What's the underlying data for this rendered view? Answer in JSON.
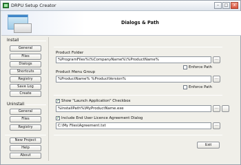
{
  "window": {
    "title": "DRPU Setup Creator",
    "controls": {
      "minimize": "–",
      "maximize": "□",
      "close": "x"
    }
  },
  "header": {
    "title": "Dialogs & Path"
  },
  "sidebar": {
    "install_label": "Install",
    "install_items": [
      "General",
      "Files",
      "Dialogs",
      "Shortcuts",
      "Registry",
      "Save Log",
      "Create"
    ],
    "uninstall_label": "Uninstall",
    "uninstall_items": [
      "General",
      "Files",
      "Registry"
    ],
    "bottom_items": [
      "New Project",
      "Help",
      "About"
    ]
  },
  "main": {
    "product_folder": {
      "label": "Product Folder",
      "value": "%ProgramFiles%\\%CompanyName%\\%ProductName%",
      "enforce_label": "Enforce Path",
      "browse": "..."
    },
    "product_menu_group": {
      "label": "Product Menu Group",
      "value": "%ProductName% %ProductVersion%",
      "enforce_label": "Enforce Path",
      "browse": "..."
    },
    "launch_app": {
      "checkbox_label": "Show \"Launch Application\" Checkbox",
      "checked": true,
      "value": "%InstallPath%\\MyProductName.exe",
      "browse": "...",
      "extra_button": ""
    },
    "licence": {
      "checkbox_label": "Include End User Licence Agreement Dialog",
      "checked": true,
      "value": "C:\\My Files\\Agreement.txt",
      "browse": "..."
    },
    "exit_button": "Exit"
  }
}
